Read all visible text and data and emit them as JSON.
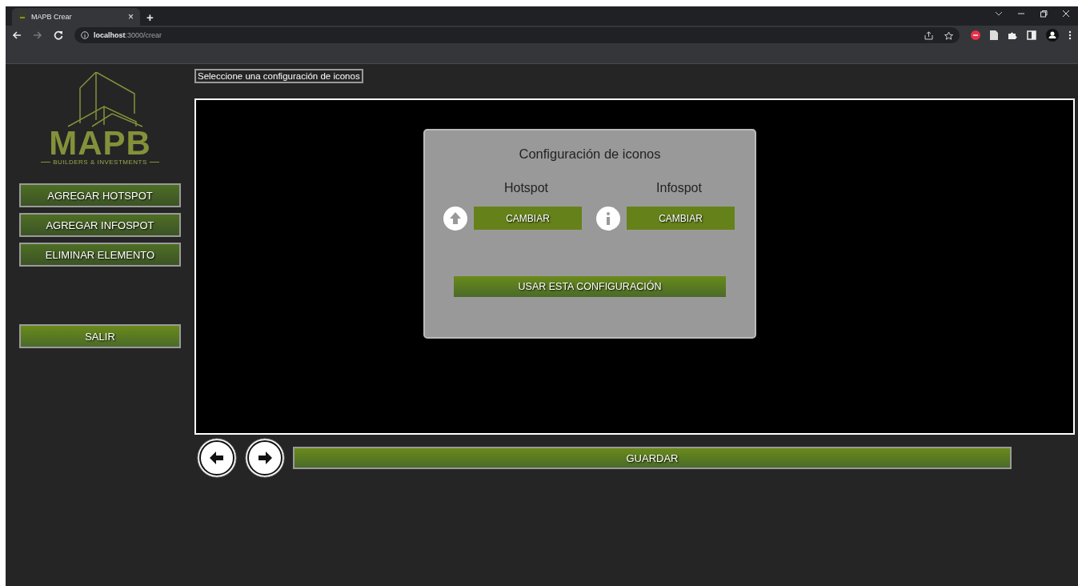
{
  "browser": {
    "tab": {
      "title": "MAPB Crear",
      "close": "×",
      "selected": true
    },
    "new_tab": "+",
    "address": "**localhost**:3000/crear"
  },
  "sidebar": {
    "logo": {
      "name": "MAPB",
      "tagline": "BUILDERS & INVESTMENTS"
    },
    "buttons": [
      {
        "label": "AGREGAR HOTSPOT",
        "kind": "dark"
      },
      {
        "label": "AGREGAR INFOSPOT",
        "kind": "dark"
      },
      {
        "label": "ELIMINAR ELEMENTO",
        "kind": "dark"
      },
      {
        "label": "SALIR",
        "kind": "bright"
      }
    ]
  },
  "main": {
    "hint": "Seleccione una configuración de iconos",
    "dialog": {
      "title": "Configuración de iconos",
      "options": [
        {
          "label": "Hotspot",
          "kind": "arrow",
          "button": "CAMBIAR"
        },
        {
          "label": "Infospot",
          "kind": "info",
          "button": "CAMBIAR"
        }
      ],
      "confirm": "USAR ESTA CONFIGURACIÓN"
    },
    "save": "GUARDAR"
  }
}
